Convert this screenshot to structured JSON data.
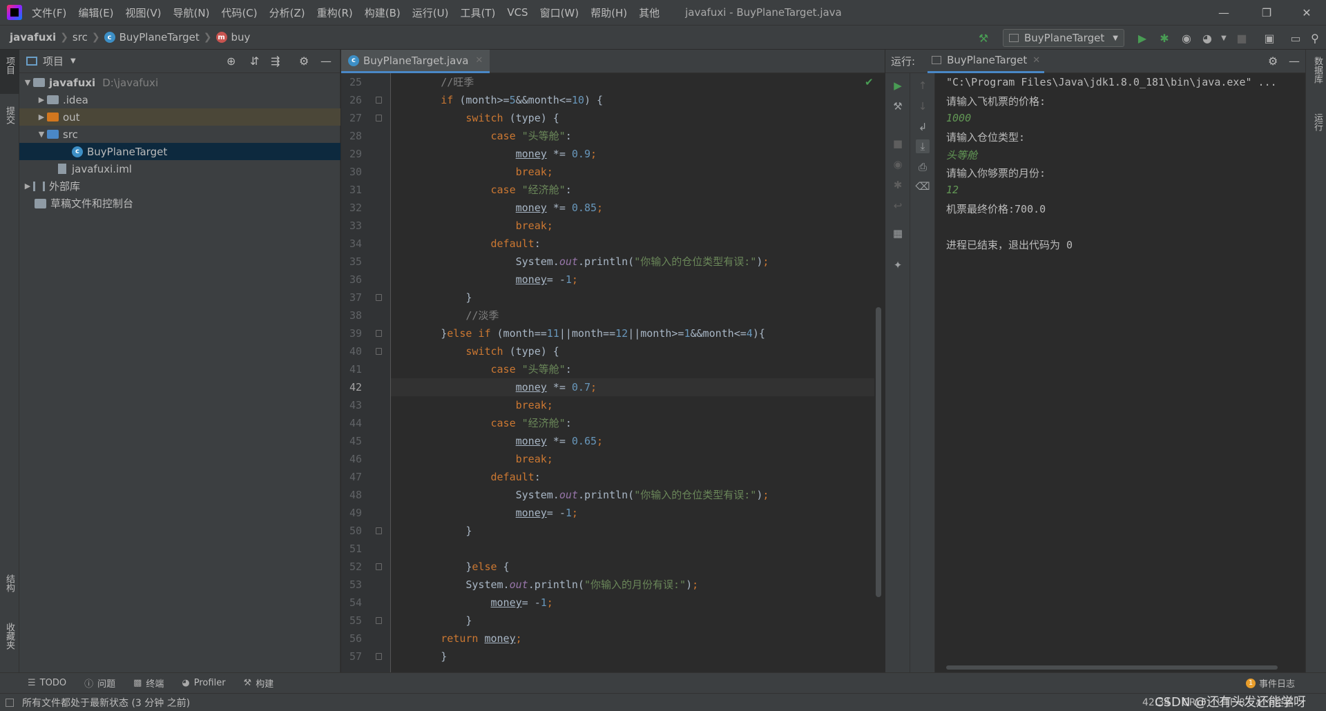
{
  "menubar": {
    "items": [
      "文件(F)",
      "编辑(E)",
      "视图(V)",
      "导航(N)",
      "代码(C)",
      "分析(Z)",
      "重构(R)",
      "构建(B)",
      "运行(U)",
      "工具(T)",
      "VCS",
      "窗口(W)",
      "帮助(H)",
      "其他"
    ],
    "window_title": "javafuxi - BuyPlaneTarget.java"
  },
  "navbar": {
    "crumbs": [
      "javafuxi",
      "src",
      "BuyPlaneTarget",
      "buy"
    ],
    "run_config": "BuyPlaneTarget"
  },
  "left_stripe": {
    "project": "项目",
    "commit": "提交",
    "structure": "结构",
    "favorites": "收藏夹"
  },
  "project_panel": {
    "title": "项目",
    "tree": [
      {
        "label": "javafuxi",
        "extra": "D:\\javafuxi"
      },
      {
        "label": ".idea"
      },
      {
        "label": "out"
      },
      {
        "label": "src"
      },
      {
        "label": "BuyPlaneTarget"
      },
      {
        "label": "javafuxi.iml"
      },
      {
        "label": "外部库"
      },
      {
        "label": "草稿文件和控制台"
      }
    ]
  },
  "editor": {
    "tab": "BuyPlaneTarget.java",
    "line_numbers": [
      "25",
      "26",
      "27",
      "28",
      "29",
      "30",
      "31",
      "32",
      "33",
      "34",
      "35",
      "36",
      "37",
      "38",
      "39",
      "40",
      "41",
      "42",
      "43",
      "44",
      "45",
      "46",
      "47",
      "48",
      "49",
      "50",
      "51",
      "52",
      "53",
      "54",
      "55",
      "56",
      "57"
    ],
    "current_line": "42",
    "strings": {
      "c_peak": "//旺季",
      "c_off": "//淡季",
      "first_class": "\"头等舱\"",
      "economy": "\"经济舱\"",
      "err_type": "\"你输入的仓位类型有误:\"",
      "err_month": "\"你输入的月份有误:\""
    },
    "numbers": {
      "n5": "5",
      "n10": "10",
      "n0_9": "0.9",
      "n0_85": "0.85",
      "n1": "1",
      "n11": "11",
      "n12": "12",
      "n4": "4",
      "n0_7": "0.7",
      "n0_65": "0.65"
    }
  },
  "run_panel": {
    "label": "运行:",
    "tab": "BuyPlaneTarget",
    "console": [
      "\"C:\\Program Files\\Java\\jdk1.8.0_181\\bin\\java.exe\" ...",
      "请输入飞机票的价格:",
      "1000",
      "请输入仓位类型:",
      "头等舱",
      "请输入你够票的月份:",
      "12",
      "机票最终价格:700.0",
      "进程已结束，退出代码为 0"
    ]
  },
  "right_stripe": {
    "database": "数据库",
    "run": "运行"
  },
  "bottom_tools": [
    "TODO",
    "问题",
    "终端",
    "Profiler",
    "构建"
  ],
  "status": {
    "message": "所有文件都处于最新状态 (3 分钟 之前)",
    "event_log": "事件日志",
    "event_count": "1",
    "position": "42:34",
    "line_sep": "CRLF",
    "encoding": "UTF-8",
    "indent": "4 个空格",
    "watermark": "CSDN @还有头发还能学呀"
  },
  "colors": {
    "keyword": "#cc7832",
    "number": "#6897bb",
    "string": "#6a8759",
    "comment": "#808080",
    "field": "#9876aa",
    "run_green": "#499c54",
    "selection": "#0d293e"
  }
}
